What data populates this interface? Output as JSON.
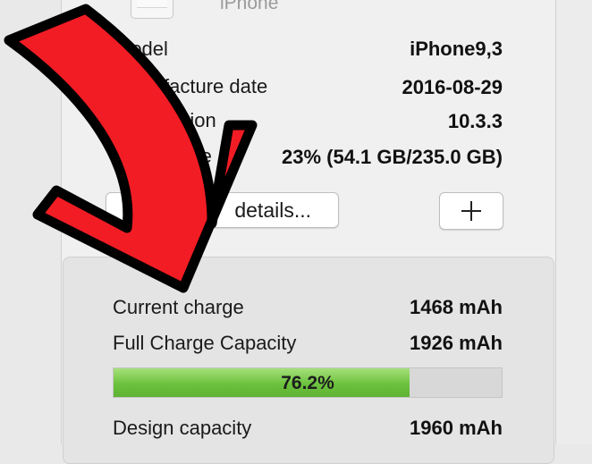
{
  "device": {
    "name": "iPhone"
  },
  "info": [
    {
      "label": "Model",
      "value": "iPhone9,3"
    },
    {
      "label": "Manufacture date",
      "value": "2016-08-29"
    },
    {
      "label": "iOS version",
      "value": "10.3.3"
    },
    {
      "label": "Disk usage",
      "value": "23% (54.1 GB/235.0 GB)"
    }
  ],
  "buttons": {
    "details_label": "details...",
    "plus_icon": "plus-icon"
  },
  "battery": {
    "current_charge": {
      "label": "Current charge",
      "value": "1468 mAh"
    },
    "full_charge_capacity": {
      "label": "Full Charge Capacity",
      "value": "1926 mAh"
    },
    "health_percent": 76.2,
    "health_label": "76.2%",
    "design_capacity": {
      "label": "Design capacity",
      "value": "1960 mAh"
    }
  },
  "colors": {
    "progress_fill": "#6cc23d",
    "progress_track": "#d8d8d8",
    "arrow_fill": "#f21c24",
    "arrow_outline": "#000000"
  }
}
